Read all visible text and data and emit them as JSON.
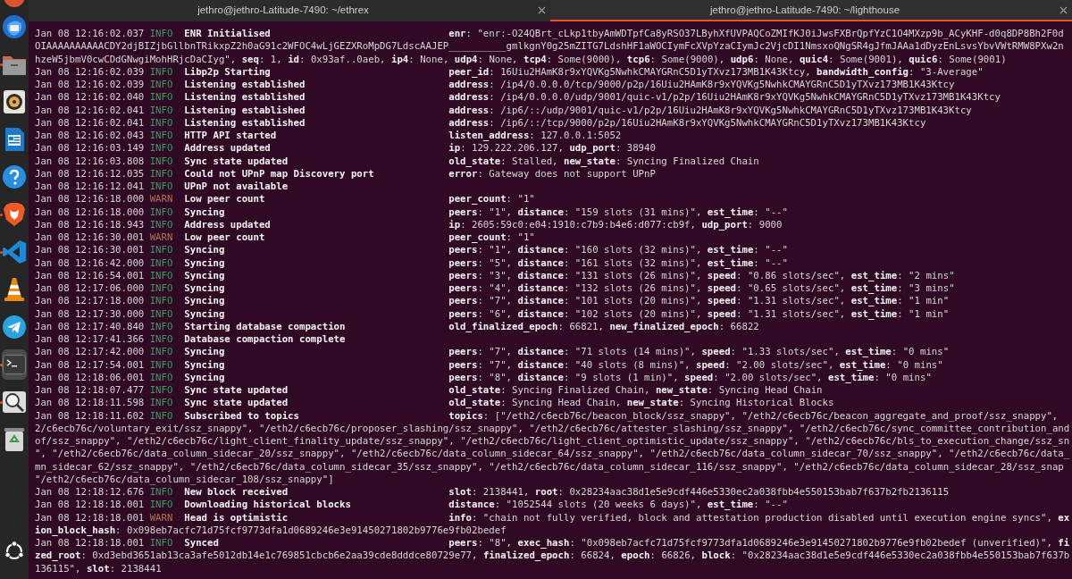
{
  "dock": {
    "items": [
      {
        "kind": "partial",
        "running": false,
        "selected": false
      },
      {
        "kind": "mail",
        "running": false,
        "selected": false
      },
      {
        "kind": "files",
        "running": true,
        "selected": false
      },
      {
        "kind": "speaker",
        "running": false,
        "selected": false
      },
      {
        "kind": "writer",
        "running": false,
        "selected": false
      },
      {
        "kind": "help",
        "running": false,
        "selected": false
      },
      {
        "kind": "lion",
        "running": true,
        "selected": false
      },
      {
        "kind": "code",
        "running": true,
        "selected": false
      },
      {
        "kind": "cone",
        "running": false,
        "selected": false
      },
      {
        "kind": "plane",
        "running": false,
        "selected": false
      },
      {
        "kind": "terminal",
        "running": true,
        "selected": true
      },
      {
        "kind": "magnifier",
        "running": true,
        "selected": false
      },
      {
        "kind": "trash",
        "running": false,
        "selected": false
      },
      {
        "kind": "ubuntu",
        "running": false,
        "selected": false
      }
    ]
  },
  "tabs": [
    {
      "title": "jethro@jethro-Latitude-7490: ~/ethrex",
      "selected": false
    },
    {
      "title": "jethro@jethro-Latitude-7490: ~/lighthouse",
      "selected": true
    }
  ],
  "lines": [
    {
      "kind": "entry",
      "timestamp": "Jan 08 12:16:02.037",
      "level": "INFO",
      "message": "ENR Initialised",
      "fields": "**enr**: \"enr:-O24QBrt_cLkp1tbyAmWDTpfCa8yRSO37LByhXfUVPAQCoZMIfKJ0iJwsFXBrQpfYzC1O4MXzp9b_ACyKHF-d0q8DP8Bh2F0d"
    },
    {
      "kind": "wrap",
      "text": "OIAAAAAAAAAACDY2djBIZjbGllbnTRikxpZ2h0aG91c2WFOC4wLjGEZXRoMpDG7LdscAAJEP__________gmlkgnY0g25mZITG7LdshHF1aWOCIymFcXVpYzaCIymJc2VjcDI1NmsxoQNgSR4gJfmJAAa1dDyzEnLsvsYbvVWtRMW8PXw2n"
    },
    {
      "kind": "wrap",
      "text": "hzeW5jbmV0cwCDdGNwgiMohHRjcDaCIyg\", **seq**: 1, **id**: 0x93af..0aeb, **ip4**: None, **udp4**: None, **tcp4**: Some(9000), **tcp6**: Some(9000), **udp6**: None, **quic4**: Some(9001), **quic6**: Some(9001)"
    },
    {
      "kind": "entry",
      "timestamp": "Jan 08 12:16:02.039",
      "level": "INFO",
      "message": "Libp2p Starting",
      "fields": "**peer_id**: 16Uiu2HAmK8r9xYQVKg5NwhkCMAYGRnC5D1yTXvz173MB1K43Ktcy, **bandwidth_config**: \"3-Average\""
    },
    {
      "kind": "entry",
      "timestamp": "Jan 08 12:16:02.039",
      "level": "INFO",
      "message": "Listening established",
      "fields": "**address**: /ip4/0.0.0.0/tcp/9000/p2p/16Uiu2HAmK8r9xYQVKg5NwhkCMAYGRnC5D1yTXvz173MB1K43Ktcy"
    },
    {
      "kind": "entry",
      "timestamp": "Jan 08 12:16:02.040",
      "level": "INFO",
      "message": "Listening established",
      "fields": "**address**: /ip4/0.0.0.0/udp/9001/quic-v1/p2p/16Uiu2HAmK8r9xYQVKg5NwhkCMAYGRnC5D1yTXvz173MB1K43Ktcy"
    },
    {
      "kind": "entry",
      "timestamp": "Jan 08 12:16:02.041",
      "level": "INFO",
      "message": "Listening established",
      "fields": "**address**: /ip6/::/udp/9001/quic-v1/p2p/16Uiu2HAmK8r9xYQVKg5NwhkCMAYGRnC5D1yTXvz173MB1K43Ktcy"
    },
    {
      "kind": "entry",
      "timestamp": "Jan 08 12:16:02.041",
      "level": "INFO",
      "message": "Listening established",
      "fields": "**address**: /ip6/::/tcp/9000/p2p/16Uiu2HAmK8r9xYQVKg5NwhkCMAYGRnC5D1yTXvz173MB1K43Ktcy"
    },
    {
      "kind": "entry",
      "timestamp": "Jan 08 12:16:02.043",
      "level": "INFO",
      "message": "HTTP API started",
      "fields": "**listen_address**: 127.0.0.1:5052"
    },
    {
      "kind": "entry",
      "timestamp": "Jan 08 12:16:03.149",
      "level": "INFO",
      "message": "Address updated",
      "fields": "**ip**: 129.222.206.127, **udp_port**: 38940"
    },
    {
      "kind": "entry",
      "timestamp": "Jan 08 12:16:03.808",
      "level": "INFO",
      "message": "Sync state updated",
      "fields": "**old_state**: Stalled, **new_state**: Syncing Finalized Chain"
    },
    {
      "kind": "entry",
      "timestamp": "Jan 08 12:16:12.035",
      "level": "INFO",
      "message": "Could not UPnP map Discovery port",
      "fields": "**error**: Gateway does not support UPnP"
    },
    {
      "kind": "entry",
      "timestamp": "Jan 08 12:16:12.041",
      "level": "INFO",
      "message": "UPnP not available"
    },
    {
      "kind": "entry",
      "timestamp": "Jan 08 12:16:18.000",
      "level": "WARN",
      "message": "Low peer count",
      "fields": "**peer_count**: \"1\""
    },
    {
      "kind": "entry",
      "timestamp": "Jan 08 12:16:18.000",
      "level": "INFO",
      "message": "Syncing",
      "fields": "**peers**: \"1\", **distance**: \"159 slots (31 mins)\", **est_time**: \"--\""
    },
    {
      "kind": "entry",
      "timestamp": "Jan 08 12:16:18.943",
      "level": "INFO",
      "message": "Address updated",
      "fields": "**ip**: 2605:59c0:e04:1910:c7b9:b4e6:d077:cb9f, **udp_port**: 9000"
    },
    {
      "kind": "entry",
      "timestamp": "Jan 08 12:16:30.001",
      "level": "WARN",
      "message": "Low peer count",
      "fields": "**peer_count**: \"1\""
    },
    {
      "kind": "entry",
      "timestamp": "Jan 08 12:16:30.001",
      "level": "INFO",
      "message": "Syncing",
      "fields": "**peers**: \"1\", **distance**: \"160 slots (32 mins)\", **est_time**: \"--\""
    },
    {
      "kind": "entry",
      "timestamp": "Jan 08 12:16:42.000",
      "level": "INFO",
      "message": "Syncing",
      "fields": "**peers**: \"5\", **distance**: \"161 slots (32 mins)\", **est_time**: \"--\""
    },
    {
      "kind": "entry",
      "timestamp": "Jan 08 12:16:54.001",
      "level": "INFO",
      "message": "Syncing",
      "fields": "**peers**: \"3\", **distance**: \"131 slots (26 mins)\", **speed**: \"0.86 slots/sec\", **est_time**: \"2 mins\""
    },
    {
      "kind": "entry",
      "timestamp": "Jan 08 12:17:06.000",
      "level": "INFO",
      "message": "Syncing",
      "fields": "**peers**: \"4\", **distance**: \"132 slots (26 mins)\", **speed**: \"0.65 slots/sec\", **est_time**: \"3 mins\""
    },
    {
      "kind": "entry",
      "timestamp": "Jan 08 12:17:18.000",
      "level": "INFO",
      "message": "Syncing",
      "fields": "**peers**: \"7\", **distance**: \"101 slots (20 mins)\", **speed**: \"1.31 slots/sec\", **est_time**: \"1 min\""
    },
    {
      "kind": "entry",
      "timestamp": "Jan 08 12:17:30.000",
      "level": "INFO",
      "message": "Syncing",
      "fields": "**peers**: \"6\", **distance**: \"102 slots (20 mins)\", **speed**: \"1.31 slots/sec\", **est_time**: \"1 min\""
    },
    {
      "kind": "entry",
      "timestamp": "Jan 08 12:17:40.840",
      "level": "INFO",
      "message": "Starting database compaction",
      "fields": "**old_finalized_epoch**: 66821, **new_finalized_epoch**: 66822"
    },
    {
      "kind": "entry",
      "timestamp": "Jan 08 12:17:41.366",
      "level": "INFO",
      "message": "Database compaction complete"
    },
    {
      "kind": "entry",
      "timestamp": "Jan 08 12:17:42.000",
      "level": "INFO",
      "message": "Syncing",
      "fields": "**peers**: \"7\", **distance**: \"71 slots (14 mins)\", **speed**: \"1.33 slots/sec\", **est_time**: \"0 mins\""
    },
    {
      "kind": "entry",
      "timestamp": "Jan 08 12:17:54.001",
      "level": "INFO",
      "message": "Syncing",
      "fields": "**peers**: \"7\", **distance**: \"40 slots (8 mins)\", **speed**: \"2.00 slots/sec\", **est_time**: \"0 mins\""
    },
    {
      "kind": "entry",
      "timestamp": "Jan 08 12:18:06.001",
      "level": "INFO",
      "message": "Syncing",
      "fields": "**peers**: \"8\", **distance**: \"9 slots (1 min)\", **speed**: \"2.00 slots/sec\", **est_time**: \"0 mins\""
    },
    {
      "kind": "entry",
      "timestamp": "Jan 08 12:18:07.477",
      "level": "INFO",
      "message": "Sync state updated",
      "fields": "**old_state**: Syncing Finalized Chain, **new_state**: Syncing Head Chain"
    },
    {
      "kind": "entry",
      "timestamp": "Jan 08 12:18:11.598",
      "level": "INFO",
      "message": "Sync state updated",
      "fields": "**old_state**: Syncing Head Chain, **new_state**: Syncing Historical Blocks"
    },
    {
      "kind": "entry",
      "timestamp": "Jan 08 12:18:11.602",
      "level": "INFO",
      "message": "Subscribed to topics",
      "fields": "**topics**: [\"/eth2/c6ecb76c/beacon_block/ssz_snappy\", \"/eth2/c6ecb76c/beacon_aggregate_and_proof/ssz_snappy\","
    },
    {
      "kind": "wrap",
      "text": "2/c6ecb76c/voluntary_exit/ssz_snappy\", \"/eth2/c6ecb76c/proposer_slashing/ssz_snappy\", \"/eth2/c6ecb76c/attester_slashing/ssz_snappy\", \"/eth2/c6ecb76c/sync_committee_contribution_and"
    },
    {
      "kind": "wrap",
      "text": "of/ssz_snappy\", \"/eth2/c6ecb76c/light_client_finality_update/ssz_snappy\", \"/eth2/c6ecb76c/light_client_optimistic_update/ssz_snappy\", \"/eth2/c6ecb76c/bls_to_execution_change/ssz_sn"
    },
    {
      "kind": "wrap",
      "text": "\", \"/eth2/c6ecb76c/data_column_sidecar_20/ssz_snappy\", \"/eth2/c6ecb76c/data_column_sidecar_64/ssz_snappy\", \"/eth2/c6ecb76c/data_column_sidecar_70/ssz_snappy\", \"/eth2/c6ecb76c/data_"
    },
    {
      "kind": "wrap",
      "text": "mn_sidecar_62/ssz_snappy\", \"/eth2/c6ecb76c/data_column_sidecar_35/ssz_snappy\", \"/eth2/c6ecb76c/data_column_sidecar_116/ssz_snappy\", \"/eth2/c6ecb76c/data_column_sidecar_28/ssz_snap"
    },
    {
      "kind": "wrap",
      "text": "\"/eth2/c6ecb76c/data_column_sidecar_108/ssz_snappy\"]"
    },
    {
      "kind": "entry",
      "timestamp": "Jan 08 12:18:12.676",
      "level": "INFO",
      "message": "New block received",
      "fields": "**slot**: 2138441, **root**: 0x28234aac38d1e5e9cdf446e5330ec2a038fbb4e550153bab7f637b2fb2136115"
    },
    {
      "kind": "entry",
      "timestamp": "Jan 08 12:18:18.001",
      "level": "INFO",
      "message": "Downloading historical blocks",
      "fields": "**distance**: \"1052544 slots (20 weeks 6 days)\", **est_time**: \"--\""
    },
    {
      "kind": "entry",
      "timestamp": "Jan 08 12:18:18.001",
      "level": "WARN",
      "message": "Head is optimistic",
      "fields": "**info**: \"chain not fully verified, block and attestation production disabled until execution engine syncs\", **ex**"
    },
    {
      "kind": "wrap",
      "text": "**ion_block_hash**: 0x098eb7acfc71d75fcf9773dfa1d0689246e3e91450271802b9776e9fb02bedef"
    },
    {
      "kind": "entry",
      "timestamp": "Jan 08 12:18:18.001",
      "level": "INFO",
      "message": "Synced",
      "fields": "**peers**: \"8\", **exec_hash**: \"0x098eb7acfc71d75fcf9773dfa1d0689246e3e91450271802b9776e9fb02bedef (unverified)\", **fi**"
    },
    {
      "kind": "wrap",
      "text": "**zed_root**: 0xd3ebd3651ab13ca3afe5012db14e1c769851cbcb6e2aa39cde8dddce80729e77, **finalized_epoch**: 66824, **epoch**: 66826, **block**: \"0x28234aac38d1e5e9cdf446e5330ec2a038fbb4e550153bab7f637b"
    },
    {
      "kind": "wrap",
      "text": "136115\", **slot**: 2138441"
    }
  ]
}
